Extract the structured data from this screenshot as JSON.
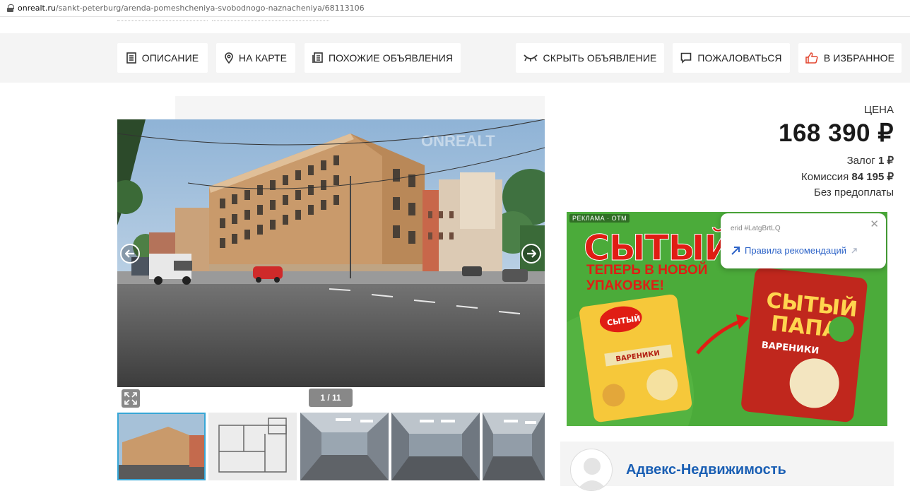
{
  "browser": {
    "url_domain": "onrealt.ru",
    "url_path": "/sankt-peterburg/arenda-pomeshcheniya-svobodnogo-naznacheniya/68113106"
  },
  "actions": {
    "description": "ОПИСАНИЕ",
    "map": "НА КАРТЕ",
    "similar": "ПОХОЖИЕ ОБЪЯВЛЕНИЯ",
    "hide": "СКРЫТЬ ОБЪЯВЛЕНИЕ",
    "complain": "ПОЖАЛОВАТЬСЯ",
    "favorite": "В ИЗБРАННОЕ"
  },
  "gallery": {
    "counter": "1 / 11",
    "watermark": "ONREALT"
  },
  "price": {
    "label": "ЦЕНА",
    "value": "168 390 ₽",
    "deposit_label": "Залог",
    "deposit_value": "1 ₽",
    "commission_label": "Комиссия",
    "commission_value": "84 195 ₽",
    "prepayment": "Без предоплаты"
  },
  "ad": {
    "mark": "РЕКЛАМА · OTM",
    "title": "СЫТЫЙ",
    "subtitle_line1": "ТЕПЕРЬ В НОВОЙ",
    "subtitle_line2": "УПАКОВКЕ!",
    "pack_brand_1": "СЫТЫЙ",
    "pack_brand_2": "ПАПА",
    "pack_product": "ВАРЕНИКИ",
    "erid": "erid #LatgBrtLQ",
    "rules": "Правила рекомендаций"
  },
  "agency": {
    "name": "Адвекс-Недвижимость"
  },
  "colors": {
    "accent_link": "#1a5fb4",
    "favorite_icon": "#e2452f",
    "thumb_active_border": "#37a6d6",
    "ad_background": "#4bab3a",
    "ad_red": "#e01d14"
  }
}
